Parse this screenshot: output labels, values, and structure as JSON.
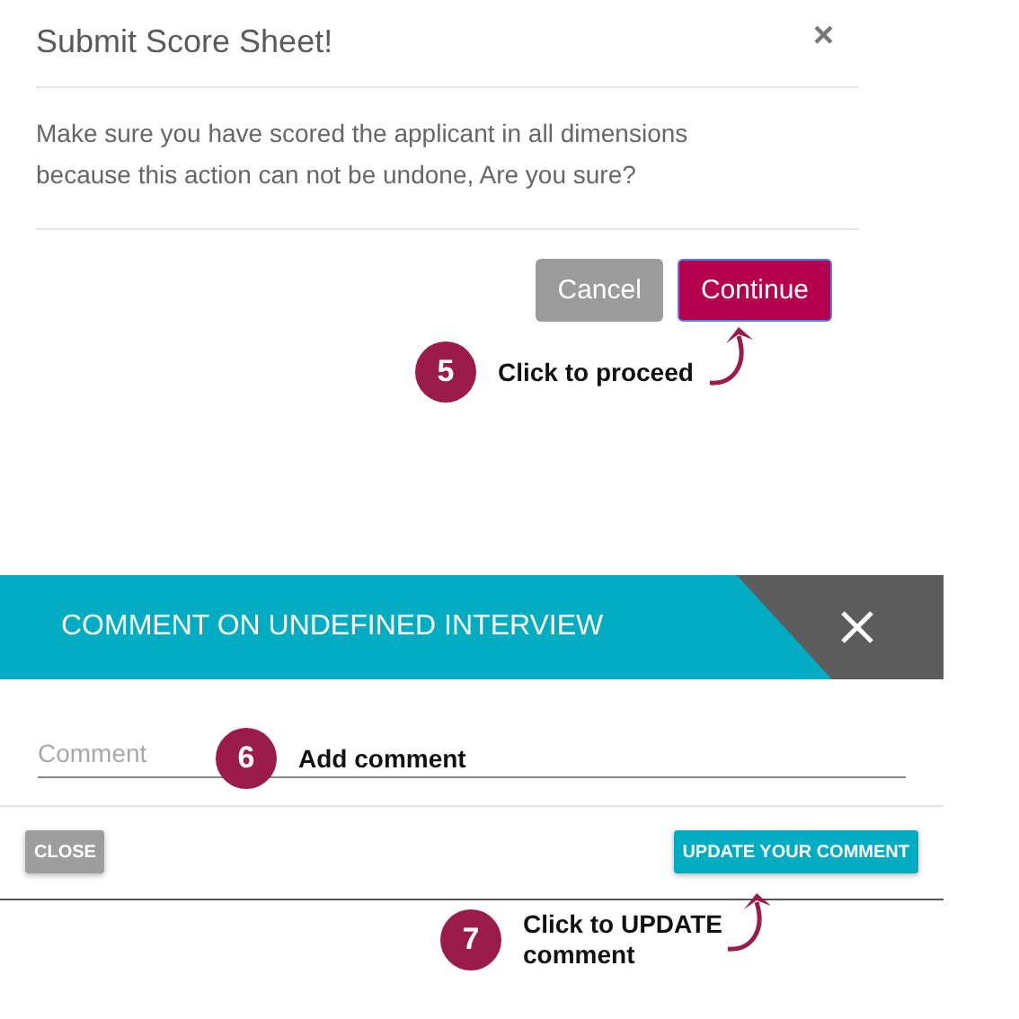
{
  "score_dialog": {
    "title": "Submit Score Sheet!",
    "close": "×",
    "message": "Make sure you have scored the applicant in all dimensions because this action can not be undone, Are you sure?",
    "buttons": [
      {
        "label": "Cancel",
        "kind": "secondary"
      },
      {
        "label": "Continue",
        "kind": "primary"
      }
    ]
  },
  "comment_dialog": {
    "title": "COMMENT ON UNDEFINED INTERVIEW",
    "comment_field": {
      "placeholder": "Comment"
    },
    "buttons": [
      {
        "label": "CLOSE",
        "kind": "secondary"
      },
      {
        "label": "UPDATE YOUR COMMENT",
        "kind": "primary"
      }
    ]
  },
  "callouts": [
    {
      "number": "5",
      "text": "Click to proceed"
    },
    {
      "number": "6",
      "text": "Add comment"
    },
    {
      "number": "7",
      "text": "Click to UPDATE comment"
    }
  ]
}
